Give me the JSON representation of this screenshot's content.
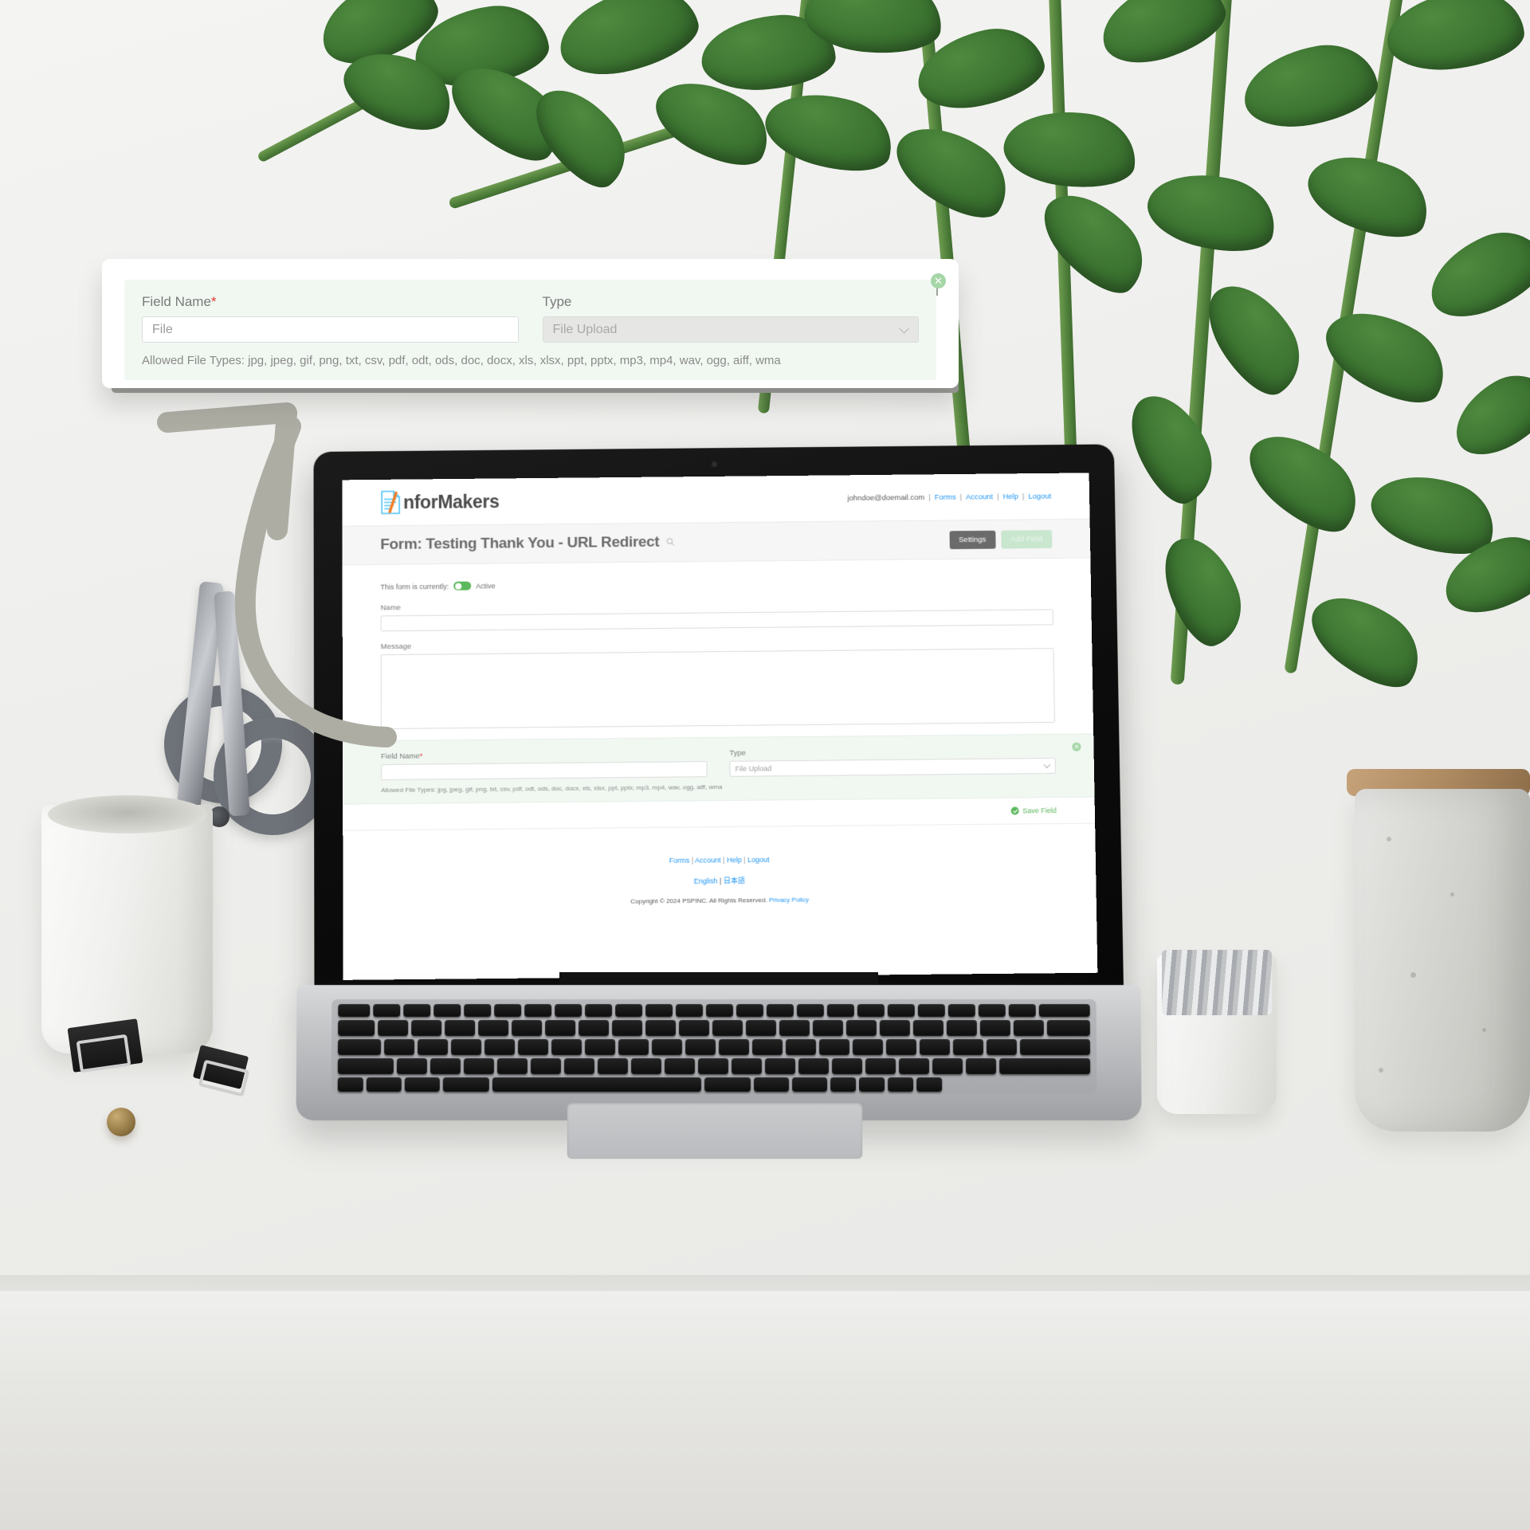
{
  "scene": {
    "description": "Desk photo mockup with laptop showing inforMakers form builder, magnified callout card and arrow"
  },
  "callout": {
    "field_name_label": "Field Name",
    "required_marker": "*",
    "field_name_value": "File",
    "type_label": "Type",
    "type_value": "File Upload",
    "allowed_types": "Allowed File Types: jpg, jpeg, gif, png, txt, csv, pdf, odt, ods, doc, docx, xls, xlsx, ppt, pptx, mp3, mp4, wav, ogg, aiff, wma",
    "remove_icon": "close-circle-icon",
    "remove_glyph": "✕",
    "panel_color": "#f1f8f2",
    "accent_color": "#a5d6a7"
  },
  "browser": {
    "header": {
      "logo_text": "nforMakers",
      "logo_icon": "document-lines-icon",
      "user_email": "johndoe@doemail.com",
      "nav": [
        {
          "label": "Forms"
        },
        {
          "label": "Account"
        },
        {
          "label": "Help"
        },
        {
          "label": "Logout"
        }
      ],
      "separator": "|"
    },
    "titlebar": {
      "title": "Form: Testing Thank You - URL Redirect",
      "search_icon": "search-icon",
      "settings_label": "Settings",
      "add_field_label": "Add Field"
    },
    "form": {
      "status_prefix": "This form is currently:",
      "status_value": "Active",
      "toggle_state": "on",
      "fields": [
        {
          "label": "Name",
          "type": "text",
          "value": "",
          "placeholder": ""
        },
        {
          "label": "Message",
          "type": "textarea",
          "value": "",
          "placeholder": ""
        }
      ],
      "editor": {
        "field_name_label": "Field Name",
        "required_marker": "*",
        "field_name_value": "",
        "type_label": "Type",
        "type_value": "File Upload",
        "allowed_types": "Allowed File Types: jpg, jpeg, gif, png, txt, csv, pdf, odt, ods, doc, docx, xls, xlsx, ppt, pptx, mp3, mp4, wav, ogg, aiff, wma",
        "remove_glyph": "✕"
      },
      "save_field_label": "Save Field",
      "save_check_glyph": "✓"
    },
    "footer": {
      "links": [
        {
          "label": "Forms"
        },
        {
          "label": "Account"
        },
        {
          "label": "Help"
        },
        {
          "label": "Logout"
        }
      ],
      "separator": "|",
      "languages": [
        {
          "label": "English"
        },
        {
          "label": "日本語"
        }
      ],
      "copyright": "Copyright © 2024 PSPINC. All Rights Reserved.",
      "privacy_label": "Privacy Policy"
    }
  },
  "colors": {
    "link_blue": "#2196f3",
    "green_accent": "#5cb85c",
    "panel_green": "#f1f8f2",
    "settings_gray": "#6b6b6b",
    "required_red": "#e53935",
    "arrow_gray": "#adada4"
  }
}
